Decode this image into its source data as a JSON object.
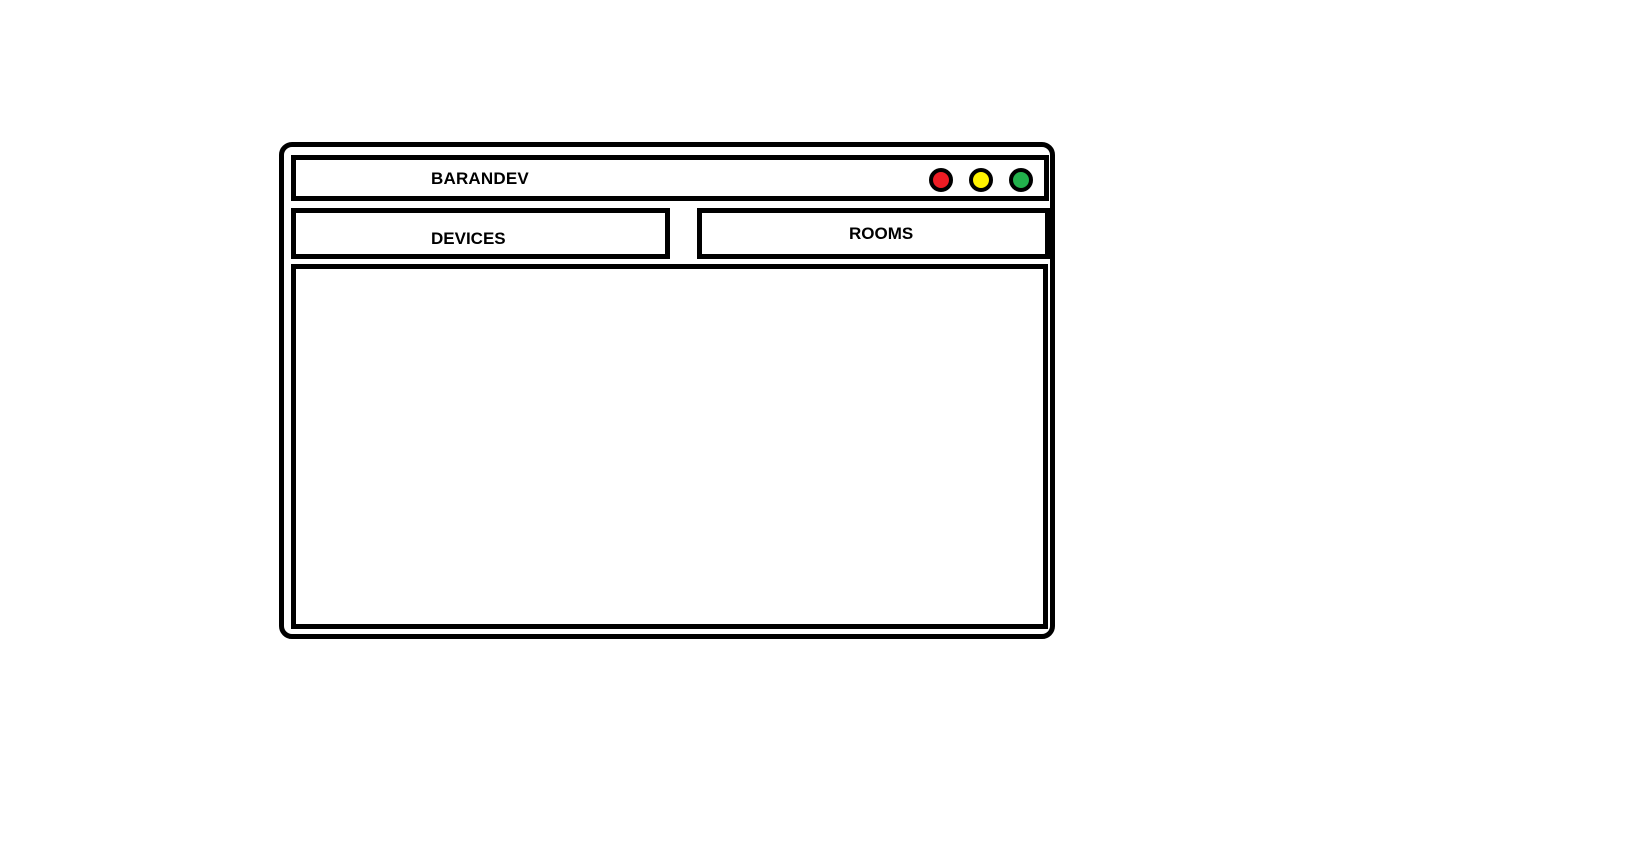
{
  "window": {
    "title": "BARANDEV",
    "controls": {
      "close_color": "#ed1c24",
      "minimize_color": "#fff200",
      "maximize_color": "#22b14c"
    }
  },
  "tabs": [
    {
      "label": "DEVICES"
    },
    {
      "label": "ROOMS"
    }
  ]
}
